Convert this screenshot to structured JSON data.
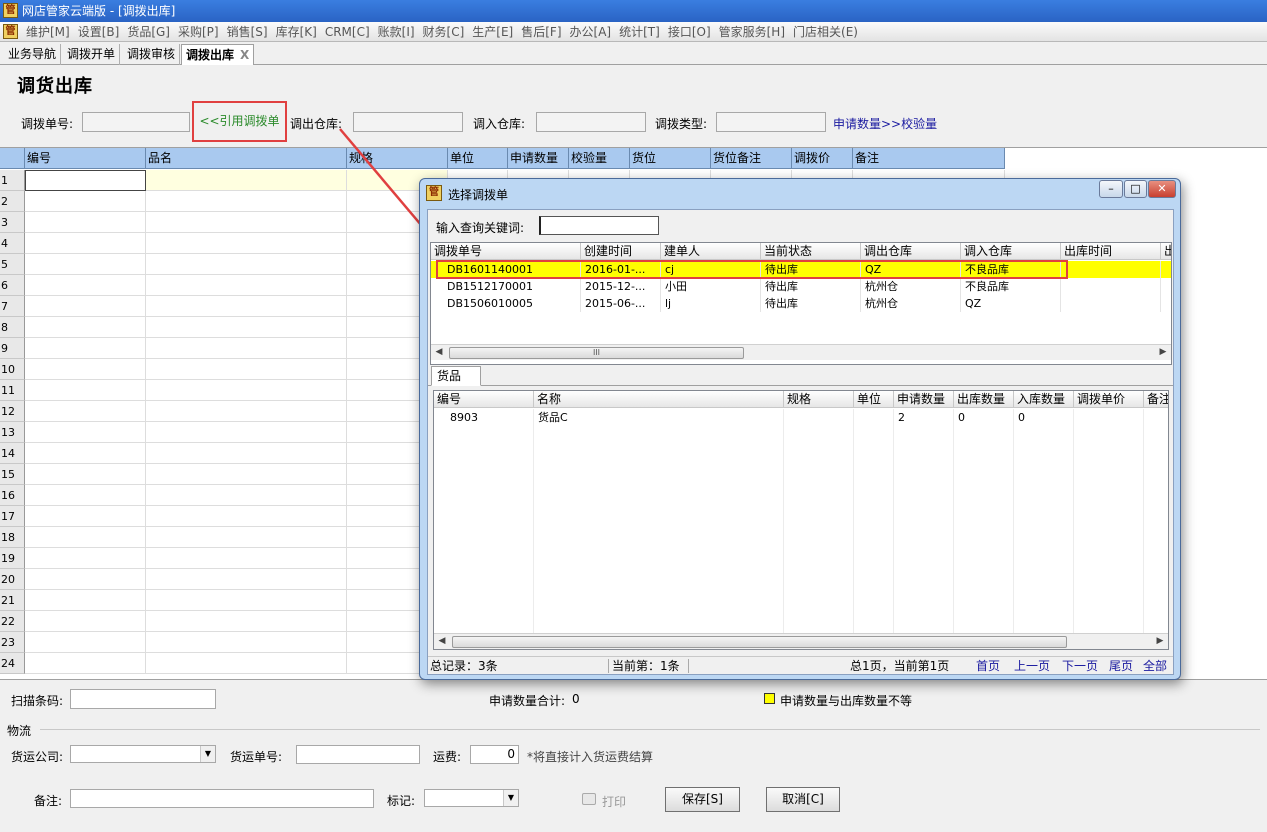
{
  "window": {
    "title": "网店管家云端版 - [调拨出库]",
    "logo": "管"
  },
  "menu": [
    "维护[M]",
    "设置[B]",
    "货品[G]",
    "采购[P]",
    "销售[S]",
    "库存[K]",
    "CRM[C]",
    "账款[I]",
    "财务[C]",
    "生产[E]",
    "售后[F]",
    "办公[A]",
    "统计[T]",
    "接口[O]",
    "管家服务[H]",
    "门店相关(E)"
  ],
  "tabs": [
    {
      "label": "业务导航"
    },
    {
      "label": "调拨开单"
    },
    {
      "label": "调拨审核"
    },
    {
      "label": "调拨出库",
      "close": "X"
    }
  ],
  "page": {
    "title": "调货出库",
    "order_no_label": "调拨单号:",
    "ref_button": "<<引用调拨单",
    "out_wh_label": "调出仓库:",
    "in_wh_label": "调入仓库:",
    "type_label": "调拨类型:",
    "check_link": "申请数量>>校验量"
  },
  "grid": {
    "columns": [
      "编号",
      "品名",
      "规格",
      "单位",
      "申请数量",
      "校验量",
      "货位",
      "货位备注",
      "调拨价",
      "备注"
    ],
    "row_numbers": [
      "1",
      "2",
      "3",
      "4",
      "5",
      "6",
      "7",
      "8",
      "9",
      "10",
      "11",
      "12",
      "13",
      "14",
      "15",
      "16",
      "17",
      "18",
      "19",
      "20",
      "21",
      "22",
      "23",
      "24"
    ]
  },
  "bottom": {
    "scan_label": "扫描条码:",
    "qty_total_label": "申请数量合计:",
    "qty_total": "0",
    "legend_text": "申请数量与出库数量不等",
    "legend_color": "#ffff00",
    "logistics_label": "物流",
    "carrier_label": "货运公司:",
    "waybill_label": "货运单号:",
    "freight_label": "运费:",
    "freight_value": "0",
    "freight_note": "*将直接计入货运费结算",
    "remark_label": "备注:",
    "mark_label": "标记:",
    "print_label": "打印",
    "save_label": "保存[S]",
    "cancel_label": "取消[C]"
  },
  "dialog": {
    "title": "选择调拨单",
    "search_label": "输入查询关键词:",
    "search_value": "",
    "columns": [
      "调拨单号",
      "创建时间",
      "建单人",
      "当前状态",
      "调出仓库",
      "调入仓库",
      "出库时间",
      "出"
    ],
    "rows": [
      {
        "no": "DB1601140001",
        "time": "2016-01-...",
        "creator": "cj",
        "status": "待出库",
        "out": "QZ",
        "in": "不良品库",
        "outtime": "",
        "selected": true
      },
      {
        "no": "DB1512170001",
        "time": "2015-12-...",
        "creator": "小田",
        "status": "待出库",
        "out": "杭州仓",
        "in": "不良品库",
        "outtime": "",
        "selected": false
      },
      {
        "no": "DB1506010005",
        "time": "2015-06-...",
        "creator": "lj",
        "status": "待出库",
        "out": "杭州仓",
        "in": "QZ",
        "outtime": "",
        "selected": false
      }
    ],
    "scroll_grip": "III",
    "sub_tab": "货品",
    "item_columns": [
      "编号",
      "名称",
      "规格",
      "单位",
      "申请数量",
      "出库数量",
      "入库数量",
      "调拨单价",
      "备注"
    ],
    "items": [
      {
        "no": "8903",
        "name": "货品C",
        "spec": "",
        "unit": "",
        "req": "2",
        "out": "0",
        "in": "0",
        "price": ""
      }
    ],
    "total_records": "总记录：3条",
    "current": "当前第：1条",
    "pages": "总1页，当前第1页",
    "nav": [
      "首页",
      "上一页",
      "下一页",
      "尾页",
      "全部"
    ],
    "highlight_color": "#ffff00",
    "annotation_color": "#e04040"
  }
}
